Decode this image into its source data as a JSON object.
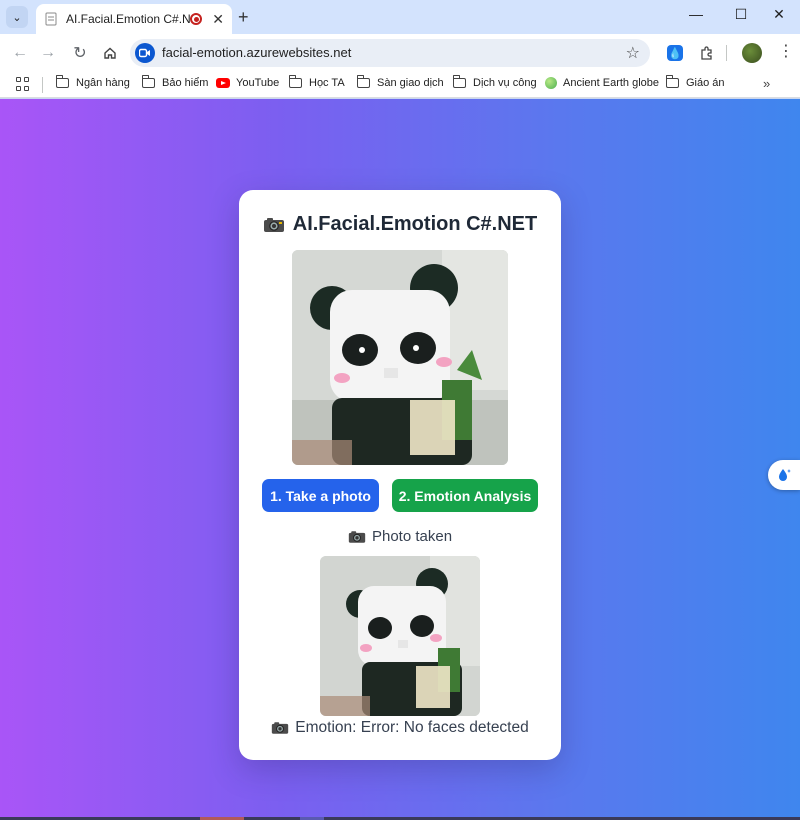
{
  "browser": {
    "tab_title": "AI.Facial.Emotion C#.NET",
    "url": "facial-emotion.azurewebsites.net",
    "bookmarks": [
      "Ngân hàng",
      "Bảo hiểm",
      "YouTube",
      "Học TA",
      "Sàn giao dịch",
      "Dịch vụ công",
      "Ancient Earth globe",
      "Giáo án"
    ]
  },
  "app": {
    "title": "AI.Facial.Emotion C#.NET",
    "take_photo_label": "1. Take a photo",
    "analyze_label": "2. Emotion Analysis",
    "photo_status": "Photo taken",
    "emotion_result": "Emotion: Error: No faces detected"
  },
  "colors": {
    "primary_button": "#2563eb",
    "analyze_button": "#16a34a",
    "gradient_start": "#a955f7",
    "gradient_end": "#3f86ee"
  }
}
